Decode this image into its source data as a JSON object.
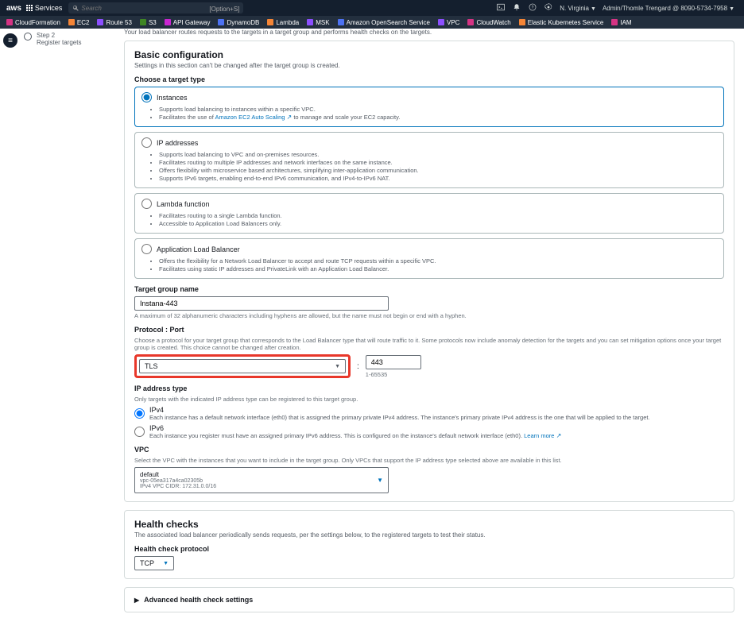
{
  "nav": {
    "logo": "aws",
    "services": "Services",
    "search_placeholder": "Search",
    "search_hint": "[Option+S]",
    "region": "N. Virginia",
    "account": "Admin/Thomle Trengard @ 8090-5734-7958"
  },
  "service_strip": [
    {
      "name": "CloudFormation",
      "color": "#d63384"
    },
    {
      "name": "EC2",
      "color": "#f58536"
    },
    {
      "name": "Route 53",
      "color": "#8c4fff"
    },
    {
      "name": "S3",
      "color": "#3f8624"
    },
    {
      "name": "API Gateway",
      "color": "#c925d1"
    },
    {
      "name": "DynamoDB",
      "color": "#4d72f3"
    },
    {
      "name": "Lambda",
      "color": "#f58536"
    },
    {
      "name": "MSK",
      "color": "#8c4fff"
    },
    {
      "name": "Amazon OpenSearch Service",
      "color": "#4d72f3"
    },
    {
      "name": "VPC",
      "color": "#8c4fff"
    },
    {
      "name": "CloudWatch",
      "color": "#d63384"
    },
    {
      "name": "Elastic Kubernetes Service",
      "color": "#f58536"
    },
    {
      "name": "IAM",
      "color": "#d63384"
    }
  ],
  "steps": {
    "s2_top": "Step 2",
    "s2_bot": "Register targets"
  },
  "intro": "Your load balancer routes requests to the targets in a target group and performs health checks on the targets.",
  "basic": {
    "title": "Basic configuration",
    "subtitle": "Settings in this section can't be changed after the target group is created.",
    "target_type_label": "Choose a target type",
    "opts": {
      "instances": {
        "title": "Instances",
        "b1": "Supports load balancing to instances within a specific VPC.",
        "b2a": "Facilitates the use of ",
        "b2link": "Amazon EC2 Auto Scaling",
        "b2b": " to manage and scale your EC2 capacity."
      },
      "ip": {
        "title": "IP addresses",
        "b1": "Supports load balancing to VPC and on-premises resources.",
        "b2": "Facilitates routing to multiple IP addresses and network interfaces on the same instance.",
        "b3": "Offers flexibility with microservice based architectures, simplifying inter-application communication.",
        "b4": "Supports IPv6 targets, enabling end-to-end IPv6 communication, and IPv4-to-IPv6 NAT."
      },
      "lambda": {
        "title": "Lambda function",
        "b1": "Facilitates routing to a single Lambda function.",
        "b2": "Accessible to Application Load Balancers only."
      },
      "alb": {
        "title": "Application Load Balancer",
        "b1": "Offers the flexibility for a Network Load Balancer to accept and route TCP requests within a specific VPC.",
        "b2": "Facilitates using static IP addresses and PrivateLink with an Application Load Balancer."
      }
    },
    "tg_name_label": "Target group name",
    "tg_name_value": "Instana-443",
    "tg_name_hint": "A maximum of 32 alphanumeric characters including hyphens are allowed, but the name must not begin or end with a hyphen.",
    "protoport": {
      "label": "Protocol : Port",
      "hint": "Choose a protocol for your target group that corresponds to the Load Balancer type that will route traffic to it. Some protocols now include anomaly detection for the targets and you can set mitigation options once your target group is created. This choice cannot be changed after creation.",
      "protocol": "TLS",
      "port": "443",
      "port_hint": "1-65535"
    },
    "iptype": {
      "label": "IP address type",
      "hint": "Only targets with the indicated IP address type can be registered to this target group.",
      "v4_title": "IPv4",
      "v4_txt": "Each instance has a default network interface (eth0) that is assigned the primary private IPv4 address. The instance's primary private IPv4 address is the one that will be applied to the target.",
      "v6_title": "IPv6",
      "v6_txt_a": "Each instance you register must have an assigned primary IPv6 address. This is configured on the instance's default network interface (eth0). ",
      "v6_learn": "Learn more"
    },
    "vpc": {
      "label": "VPC",
      "hint": "Select the VPC with the instances that you want to include in the target group. Only VPCs that support the IP address type selected above are available in this list.",
      "name": "default",
      "id": "vpc-05ea317a4ca02305b",
      "cidr": "IPv4 VPC CIDR: 172.31.0.0/16"
    }
  },
  "health": {
    "title": "Health checks",
    "subtitle": "The associated load balancer periodically sends requests, per the settings below, to the registered targets to test their status.",
    "proto_label": "Health check protocol",
    "proto_value": "TCP",
    "advanced": "Advanced health check settings"
  }
}
